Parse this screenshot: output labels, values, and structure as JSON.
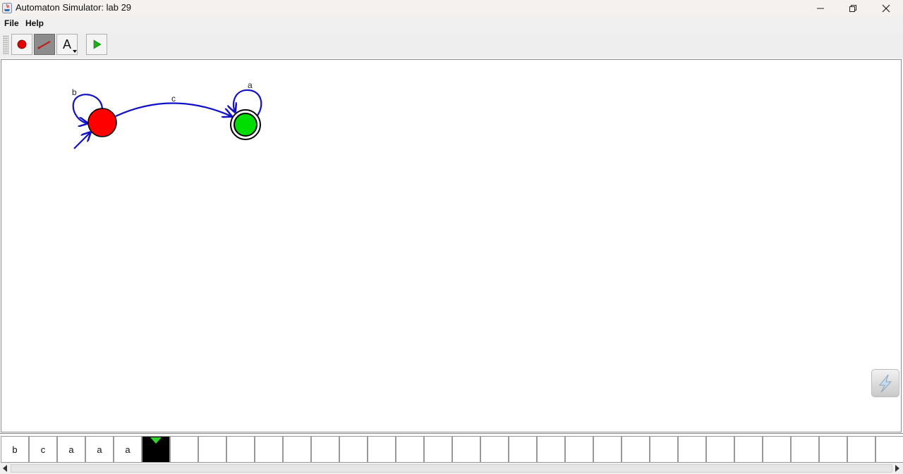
{
  "window": {
    "title": "Automaton Simulator: lab 29"
  },
  "menu": {
    "items": [
      {
        "label": "File"
      },
      {
        "label": "Help"
      }
    ]
  },
  "toolbar": {
    "tools": [
      {
        "name": "state-tool",
        "icon": "red-dot-icon"
      },
      {
        "name": "transition-tool",
        "icon": "transition-line-icon",
        "selected": true
      },
      {
        "name": "text-tool",
        "icon": "text-A-icon",
        "glyph": "A"
      },
      {
        "name": "run-tool",
        "icon": "play-icon"
      }
    ]
  },
  "automaton": {
    "states": [
      {
        "id": "s0",
        "color": "#ff0000",
        "initial": true,
        "accepting": false
      },
      {
        "id": "s1",
        "color": "#00dd00",
        "initial": false,
        "accepting": true
      }
    ],
    "transitions": [
      {
        "from": "s0",
        "to": "s0",
        "label": "b"
      },
      {
        "from": "s0",
        "to": "s1",
        "label": "c"
      },
      {
        "from": "s1",
        "to": "s1",
        "label": "a"
      }
    ],
    "edge_color": "#1010c8"
  },
  "tape": {
    "cells": [
      "b",
      "c",
      "a",
      "a",
      "a",
      "",
      "",
      "",
      "",
      "",
      "",
      "",
      "",
      "",
      "",
      "",
      "",
      "",
      "",
      "",
      "",
      "",
      "",
      "",
      "",
      "",
      "",
      "",
      "",
      "",
      "",
      ""
    ],
    "head_index": 5,
    "head_marker_color": "#2fd12f"
  }
}
